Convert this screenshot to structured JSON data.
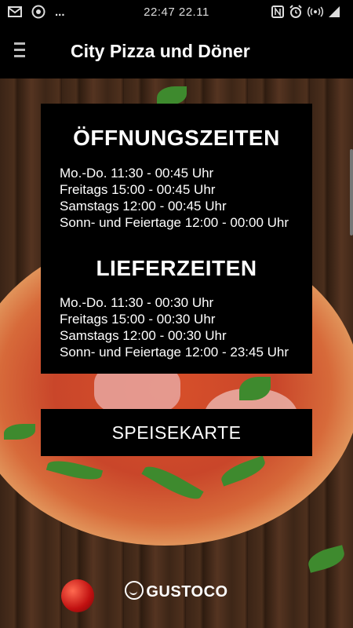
{
  "statusbar": {
    "time_date": "22:47 22.11",
    "left_icons": [
      "mail-icon",
      "target-icon",
      "more-icon"
    ],
    "right_icons": [
      "nfc-icon",
      "alarm-icon",
      "signal-strength-icon"
    ],
    "more_dots": "..."
  },
  "appbar": {
    "title": "City Pizza und Döner"
  },
  "opening_hours": {
    "title": "ÖFFNUNGSZEITEN",
    "lines": [
      "Mo.-Do. 11:30 - 00:45 Uhr",
      "Freitags 15:00 - 00:45 Uhr",
      "Samstags 12:00 - 00:45 Uhr",
      "Sonn- und Feiertage 12:00 - 00:00 Uhr"
    ]
  },
  "delivery_hours": {
    "title": "LIEFERZEITEN",
    "lines": [
      "Mo.-Do. 11:30 - 00:30 Uhr",
      "Freitags 15:00 - 00:30 Uhr",
      "Samstags 12:00 - 00:30 Uhr",
      "Sonn- und Feiertage 12:00 - 23:45 Uhr"
    ]
  },
  "menu_button": {
    "label": "SPEISEKARTE"
  },
  "footer": {
    "brand": "GUSTOCO"
  }
}
